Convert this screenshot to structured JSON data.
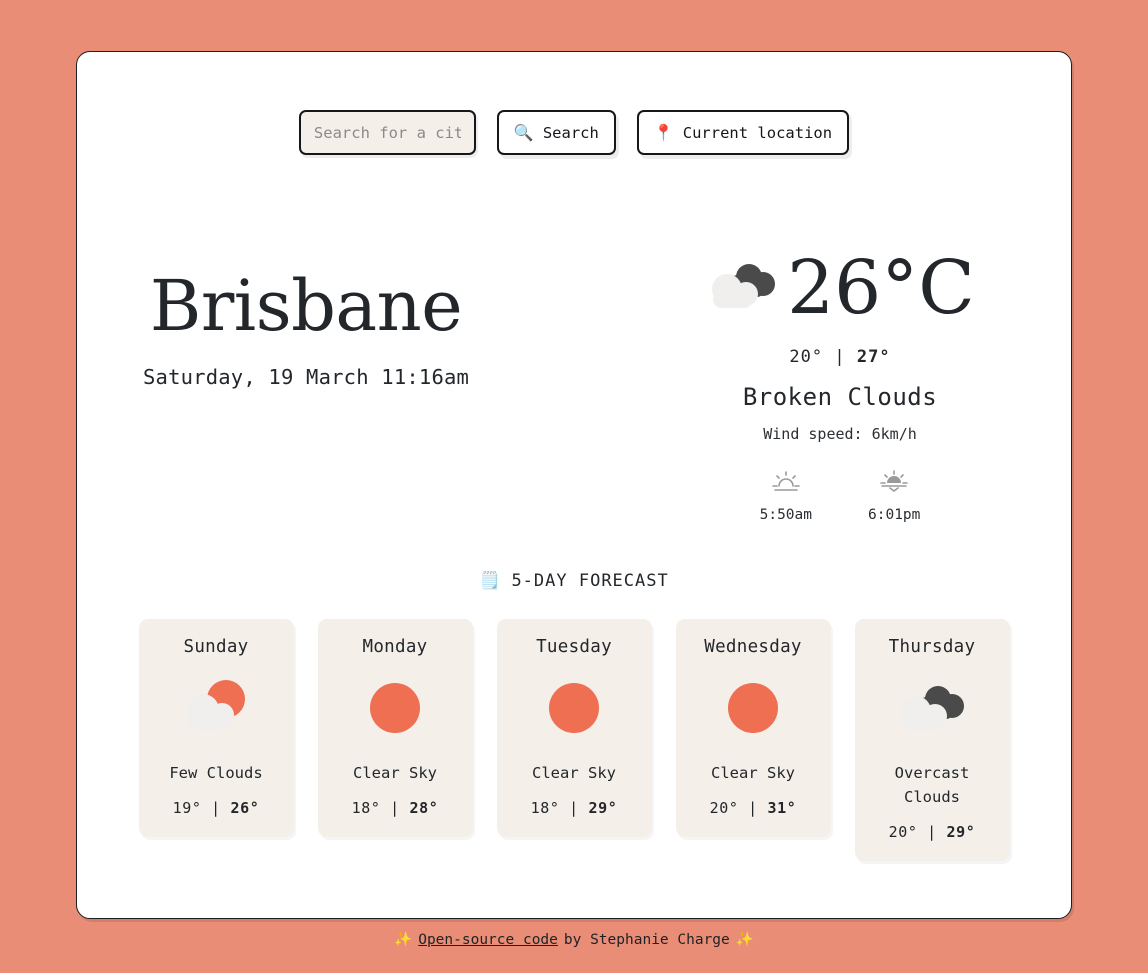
{
  "theme": {
    "page_background": "#e98d77",
    "panel_background": "#ffffff",
    "card_background": "#f4efe9",
    "accent_sun": "#ef6f52",
    "text": "#23272b",
    "cloud_dark": "#4a4a4a",
    "cloud_light": "#f0efed"
  },
  "search": {
    "placeholder": "Search for a city...",
    "value": "",
    "search_button_label": "Search",
    "search_icon": "search-icon",
    "location_button_label": "Current location",
    "location_icon": "map-pin-icon"
  },
  "current": {
    "city": "Brisbane",
    "datetime": "Saturday, 19 March 11:16am",
    "temperature": "26°C",
    "icon": "broken-clouds-icon",
    "low": "20°",
    "separator": "|",
    "high": "27°",
    "description": "Broken Clouds",
    "wind": "Wind speed: 6km/h",
    "sunrise_icon": "sunrise-icon",
    "sunrise": "5:50am",
    "sunset_icon": "sunset-icon",
    "sunset": "6:01pm"
  },
  "forecast": {
    "icon": "calendar-notepad-icon",
    "title": "5-DAY FORECAST",
    "days": [
      {
        "day": "Sunday",
        "icon": "few-clouds-icon",
        "description": "Few Clouds",
        "low": "19°",
        "separator": "|",
        "high": "26°"
      },
      {
        "day": "Monday",
        "icon": "clear-sky-icon",
        "description": "Clear Sky",
        "low": "18°",
        "separator": "|",
        "high": "28°"
      },
      {
        "day": "Tuesday",
        "icon": "clear-sky-icon",
        "description": "Clear Sky",
        "low": "18°",
        "separator": "|",
        "high": "29°"
      },
      {
        "day": "Wednesday",
        "icon": "clear-sky-icon",
        "description": "Clear Sky",
        "low": "20°",
        "separator": "|",
        "high": "31°"
      },
      {
        "day": "Thursday",
        "icon": "overcast-clouds-icon",
        "description": "Overcast Clouds",
        "low": "20°",
        "separator": "|",
        "high": "29°"
      }
    ]
  },
  "footer": {
    "sparkle_left": "✨",
    "link_text": "Open-source code",
    "by_text": "by Stephanie Charge",
    "sparkle_right": "✨"
  }
}
